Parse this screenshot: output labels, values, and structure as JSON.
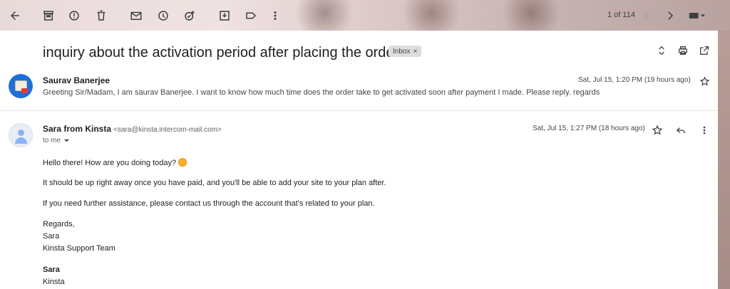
{
  "toolbar": {
    "icons": [
      "back-arrow-icon",
      "archive-icon",
      "report-spam-icon",
      "delete-icon",
      "mark-unread-icon",
      "snooze-icon",
      "add-task-icon",
      "move-to-icon",
      "label-icon",
      "more-vert-icon",
      "newer-icon",
      "older-icon",
      "keyboard-icon"
    ],
    "pager": "1 of 114"
  },
  "thread": {
    "subject": "inquiry about the activation period after placing the order.",
    "label_chip": "Inbox",
    "label_remove": "×"
  },
  "message1": {
    "sender": "Saurav Banerjee",
    "snippet": "Greeting Sir/Madam, I am saurav Banerjee. I want to know how much time does the order take to get activated soon after payment I made. Please reply. regards",
    "date": "Sat, Jul 15, 1:20 PM (19 hours ago)"
  },
  "message2": {
    "sender_name": "Sara from Kinsta",
    "sender_email": "<sara@kinsta.intercom-mail.com>",
    "to": "to me",
    "date": "Sat, Jul 15, 1:27 PM (18 hours ago)",
    "lines": {
      "greeting": "Hello there! How are you doing today?",
      "p1": "It should be up right away once you have paid, and you'll be able to add your site to your plan after.",
      "p2": "If you need further assistance, please contact us through the account that's related to your plan.",
      "regards": "Regards,",
      "sig_name": "Sara",
      "sig_team": "Kinsta Support Team",
      "sig_name_bold": "Sara",
      "sig_company": "Kinsta"
    }
  },
  "colors": {
    "panel_bg": "#ffffff",
    "text_primary": "#1f1f1f",
    "text_secondary": "#444746",
    "avatar_blue": "#1e6fd8"
  }
}
